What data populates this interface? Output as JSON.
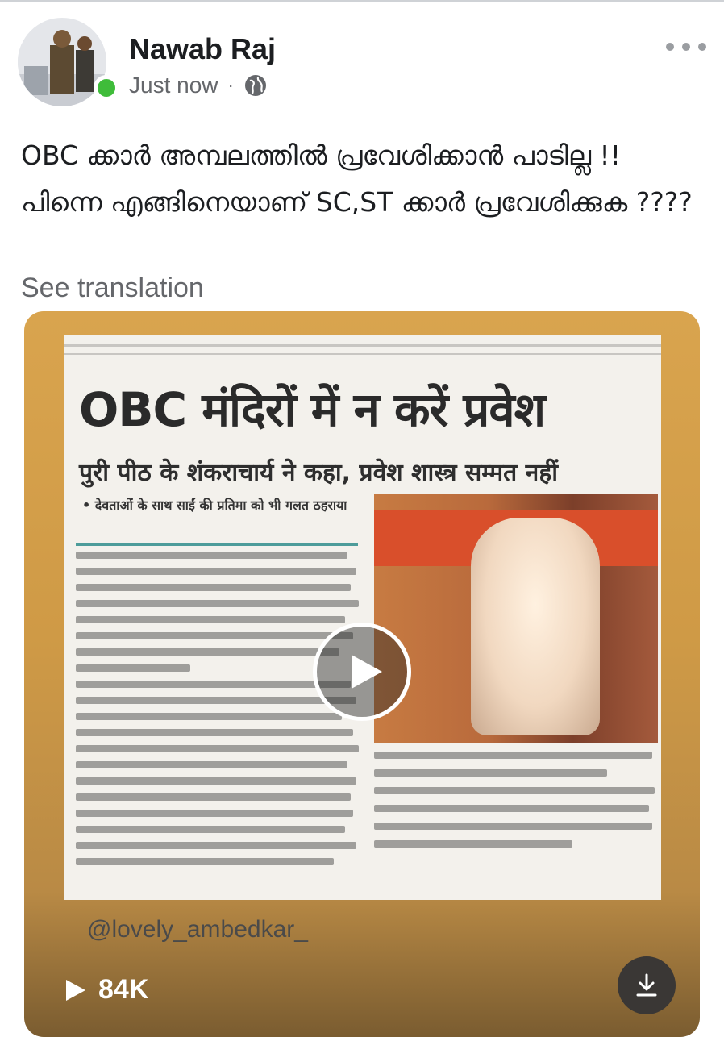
{
  "post": {
    "author": "Nawab Raj",
    "timestamp": "Just now",
    "separator": "·",
    "privacy_icon": "globe-icon",
    "text": "OBC ക്കാർ അമ്പലത്തിൽ പ്രവേശിക്കാൻ പാടില്ല !! പിന്നെ എങ്ങിനെയാണ് SC,ST  ക്കാർ പ്രവേശിക്കുക ????",
    "see_translation": "See translation"
  },
  "media": {
    "headline": "OBC मंदिरों में न करें प्रवेश",
    "subheadline": "पुरी पीठ के शंकराचार्य ने कहा, प्रवेश शास्त्र सम्मत नहीं",
    "bullet": "• देवताओं के साथ साईं की प्रतिमा को भी गलत ठहराया",
    "watermark": "@lovely_ambedkar_",
    "views": "84K",
    "play_icon": "play-icon",
    "download_icon": "download-icon"
  },
  "colors": {
    "online": "#3fbc3a",
    "card_bg": "#d9a44e",
    "secondary_text": "#65676b"
  }
}
